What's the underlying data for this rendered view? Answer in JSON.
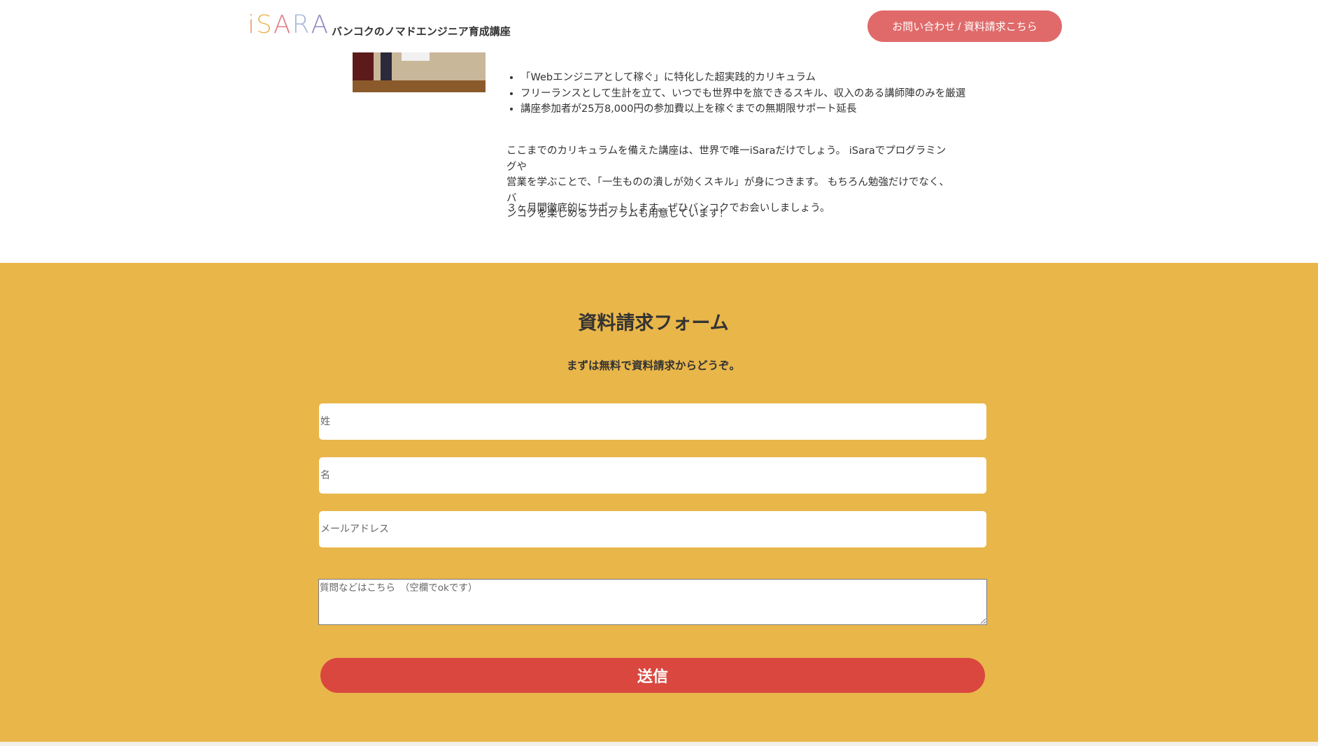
{
  "header": {
    "logo_letters": [
      "i",
      "S",
      "A",
      "R",
      "A"
    ],
    "logo_colors": [
      "#e79a6a",
      "#eab654",
      "#e27c84",
      "#a6b5d8",
      "#8d89c2"
    ],
    "tagline": "バンコクのノマドエンジニア育成講座",
    "cta_label": "お問い合わせ / 資料請求こちら",
    "cta_color": "#e06a6a"
  },
  "content": {
    "bullets": [
      "「Webエンジニアとして稼ぐ」に特化した超実践的カリキュラム",
      "フリーランスとして生計を立て、いつでも世界中を旅できるスキル、収入のある講師陣のみを厳選",
      "講座参加者が25万8,000円の参加費以上を稼ぐまでの無期限サポート延長"
    ],
    "paragraph1_lines": [
      "ここまでのカリキュラムを備えた講座は、世界で唯一iSaraだけでしょう。 iSaraでプログラミングや",
      "営業を学ぶことで、「一生ものの潰しが効くスキル」が身につきます。 もちろん勉強だけでなく、バ",
      "ンコクを楽しめるプログラムも用意しています！"
    ],
    "paragraph2": "３ヶ月間徹底的にサポートします。ぜひバンコクでお会いしましょう。"
  },
  "form": {
    "title": "資料請求フォーム",
    "subtitle": "まずは無料で資料請求からどうぞ。",
    "last_name_placeholder": "姓",
    "first_name_placeholder": "名",
    "email_placeholder": "メールアドレス",
    "question_placeholder": "質問などはこちら　（空欄でokです）",
    "submit_label": "送信",
    "background_color": "#e9b64a",
    "submit_color": "#d9473f"
  }
}
